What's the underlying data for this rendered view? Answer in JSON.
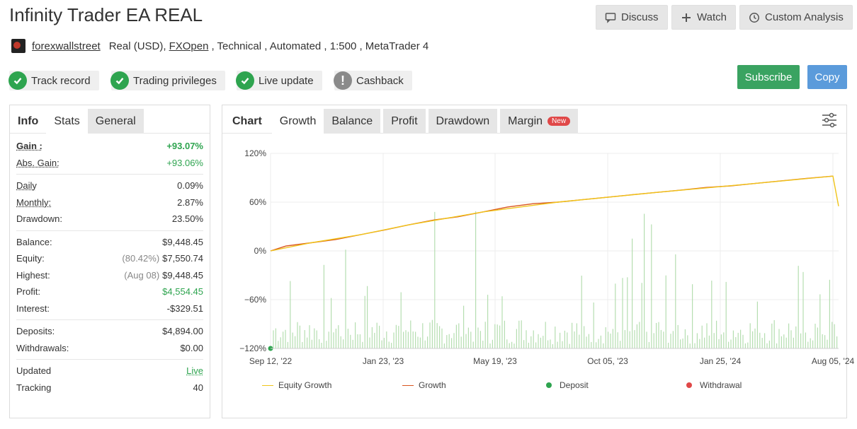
{
  "header": {
    "title": "Infinity Trader EA REAL",
    "buttons": {
      "discuss": "Discuss",
      "watch": "Watch",
      "custom_analysis": "Custom Analysis"
    }
  },
  "meta": {
    "user": "forexwallstreet",
    "account": "Real (USD),",
    "broker": "FXOpen",
    "details": ", Technical , Automated , 1:500 , MetaTrader 4"
  },
  "badges": [
    {
      "label": "Track record",
      "icon": "check-icon"
    },
    {
      "label": "Trading privileges",
      "icon": "check-icon"
    },
    {
      "label": "Live update",
      "icon": "check-icon"
    },
    {
      "label": "Cashback",
      "icon": "exclamation-icon"
    }
  ],
  "actions": {
    "subscribe": "Subscribe",
    "copy": "Copy"
  },
  "left_tabs": {
    "info": "Info",
    "stats": "Stats",
    "general": "General"
  },
  "stats": {
    "gain": {
      "label": "Gain :",
      "value": "+93.07%"
    },
    "abs_gain": {
      "label": "Abs. Gain:",
      "value": "+93.06%"
    },
    "daily": {
      "label": "Daily",
      "value": "0.09%"
    },
    "monthly": {
      "label": "Monthly:",
      "value": "2.87%"
    },
    "drawdown": {
      "label": "Drawdown:",
      "value": "23.50%"
    },
    "balance": {
      "label": "Balance:",
      "value": "$9,448.45"
    },
    "equity": {
      "label": "Equity:",
      "note": "(80.42%)",
      "value": "$7,550.74"
    },
    "highest": {
      "label": "Highest:",
      "note": "(Aug 08)",
      "value": "$9,448.45"
    },
    "profit": {
      "label": "Profit:",
      "value": "$4,554.45"
    },
    "interest": {
      "label": "Interest:",
      "value": "-$329.51"
    },
    "deposits": {
      "label": "Deposits:",
      "value": "$4,894.00"
    },
    "withdrawals": {
      "label": "Withdrawals:",
      "value": "$0.00"
    },
    "updated": {
      "label": "Updated",
      "value": "Live"
    },
    "tracking": {
      "label": "Tracking",
      "value": "40"
    }
  },
  "chart_tabs": {
    "chart": "Chart",
    "growth": "Growth",
    "balance": "Balance",
    "profit": "Profit",
    "drawdown": "Drawdown",
    "margin": "Margin",
    "new": "New"
  },
  "legend": {
    "equity": "Equity Growth",
    "growth": "Growth",
    "deposit": "Deposit",
    "withdrawal": "Withdrawal"
  },
  "colors": {
    "growth": "#d9541e",
    "equity": "#f0c419",
    "deposit": "#2ea44f",
    "withdrawal": "#e04848",
    "bars": "#b5deb0"
  },
  "chart_data": {
    "type": "line",
    "title": "",
    "xlabel": "",
    "ylabel": "",
    "ylim": [
      -120,
      120
    ],
    "xlim": [
      "2022-09-12",
      "2024-08-12"
    ],
    "yticks": [
      "120%",
      "60%",
      "0%",
      "−60%",
      "−120%"
    ],
    "xticks": [
      "Sep 12, '22",
      "Jan 23, '23",
      "May 19, '23",
      "Oct 05, '23",
      "Jan 25, '24",
      "Aug 05, '24"
    ],
    "legend_position": "bottom",
    "grid": true,
    "series": [
      {
        "name": "Growth",
        "x": [
          "2022-09-12",
          "2022-10-01",
          "2022-11-01",
          "2022-12-01",
          "2023-01-01",
          "2023-02-01",
          "2023-03-01",
          "2023-04-01",
          "2023-05-01",
          "2023-06-01",
          "2023-07-01",
          "2023-08-01",
          "2023-09-01",
          "2023-10-01",
          "2023-11-01",
          "2023-12-01",
          "2024-01-01",
          "2024-02-01",
          "2024-03-01",
          "2024-04-01",
          "2024-05-01",
          "2024-06-01",
          "2024-07-01",
          "2024-08-05"
        ],
        "y": [
          0,
          6,
          10,
          14,
          20,
          26,
          32,
          38,
          42,
          48,
          54,
          58,
          60,
          63,
          66,
          69,
          72,
          75,
          78,
          80,
          83,
          86,
          89,
          92
        ]
      },
      {
        "name": "Equity Growth",
        "x": [
          "2022-09-12",
          "2022-11-01",
          "2023-01-01",
          "2023-03-01",
          "2023-06-01",
          "2023-09-01",
          "2024-01-01",
          "2024-05-01",
          "2024-08-05",
          "2024-08-12"
        ],
        "y": [
          0,
          10,
          20,
          32,
          48,
          60,
          72,
          83,
          92,
          55
        ]
      }
    ]
  }
}
